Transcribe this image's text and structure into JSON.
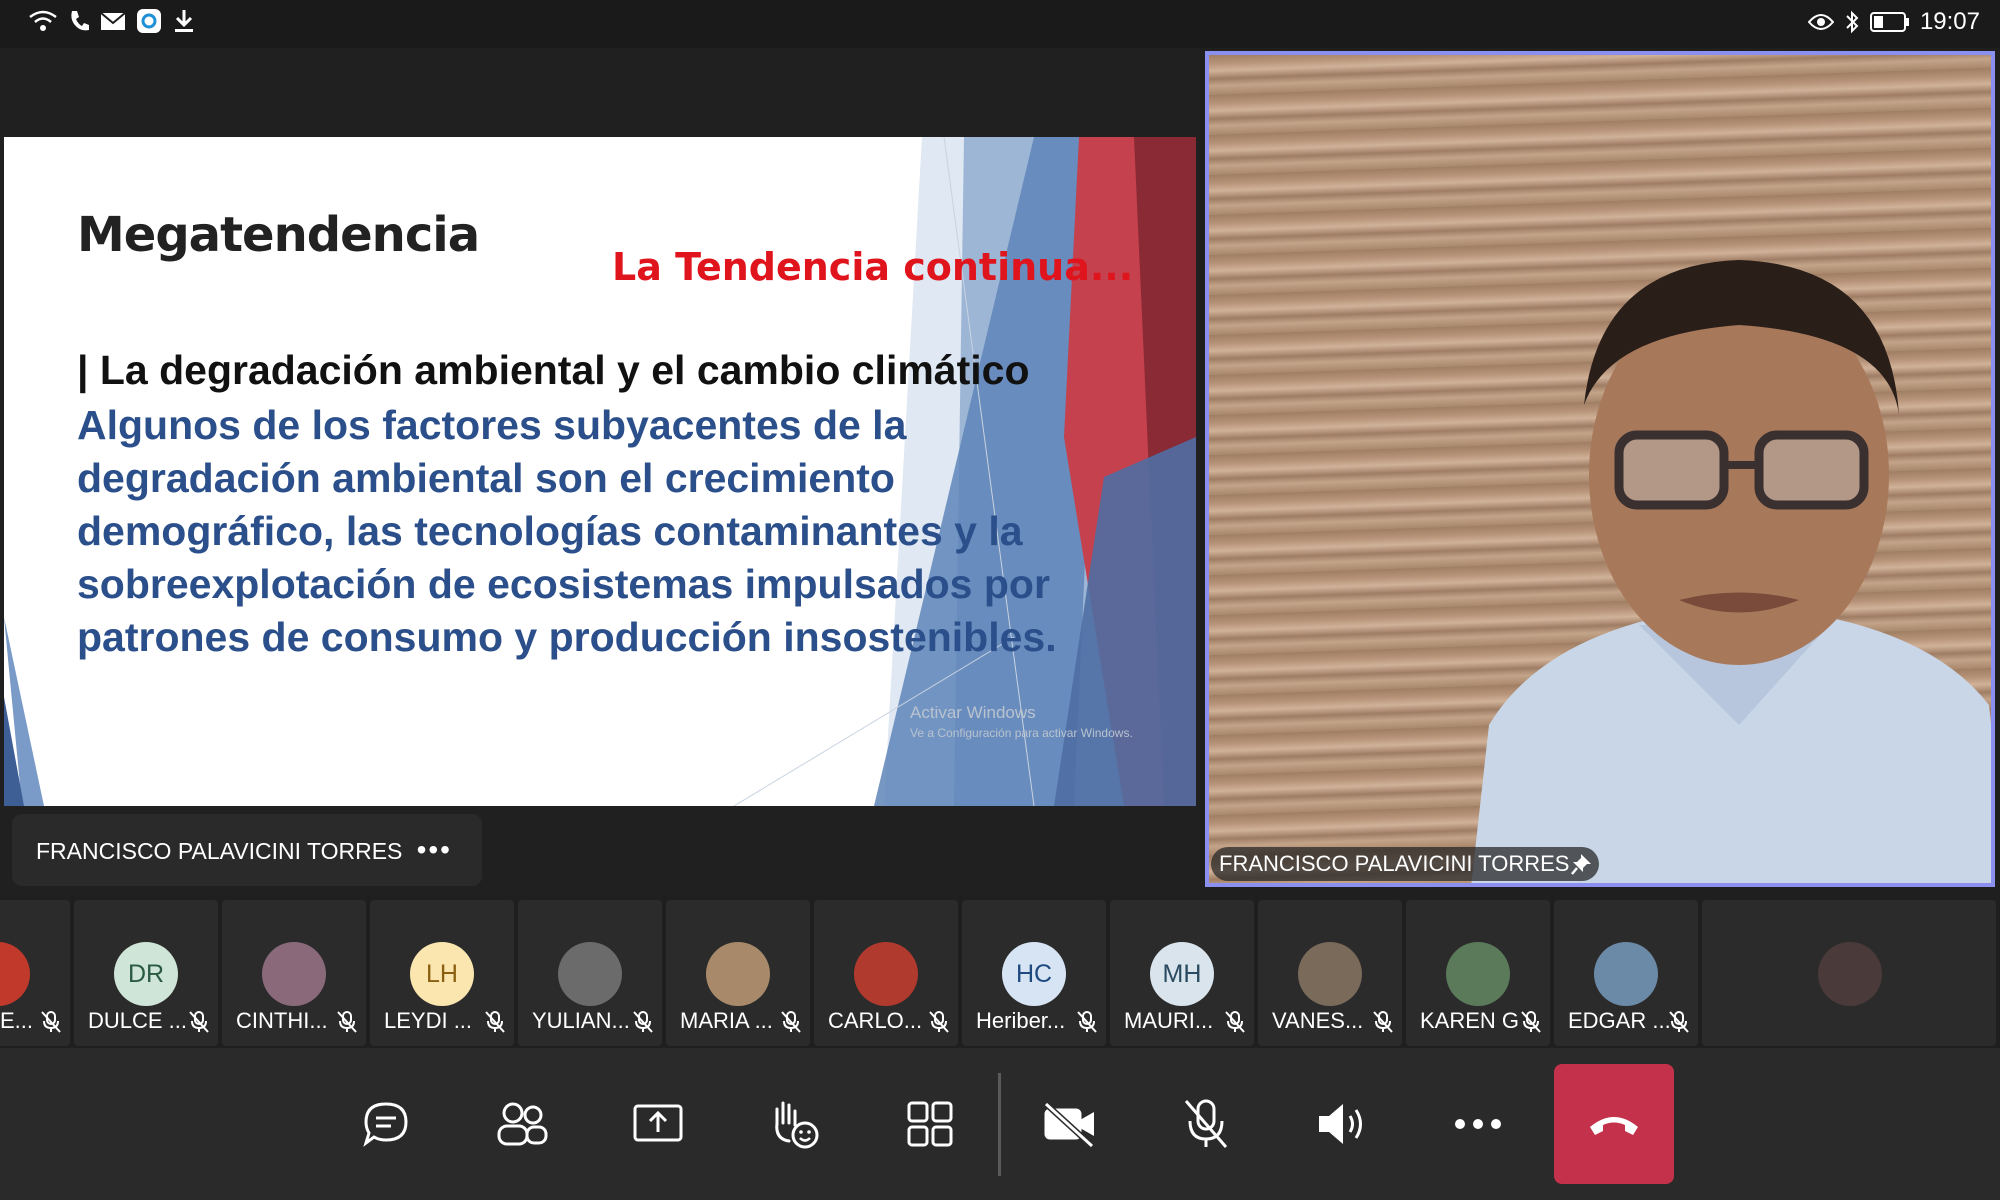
{
  "status_bar": {
    "time": "19:07"
  },
  "slide": {
    "title": "Megatendencia",
    "subtitle": "La Tendencia continua...",
    "heading": "| La degradación ambiental y el cambio climático",
    "body": "Algunos de los factores subyacentes de la degradación ambiental son el crecimiento demográfico, las tecnologías contaminantes y la sobreexplotación de ecosistemas impulsados por patrones de consumo y producción insostenibles.",
    "watermark_title": "Activar Windows",
    "watermark_sub": "Ve a Configuración para activar Windows."
  },
  "presenter": {
    "name": "FRANCISCO PALAVICINI TORRES",
    "more": "•••"
  },
  "video": {
    "name": "FRANCISCO PALAVICINI TORRES"
  },
  "participants": [
    {
      "name": "E...",
      "initials": "",
      "avatar_color": "#c0392b"
    },
    {
      "name": "DULCE ...",
      "initials": "DR",
      "avatar_color": "#cfe5d8"
    },
    {
      "name": "CINTHI...",
      "initials": "",
      "avatar_color": "#8a6a7a"
    },
    {
      "name": "LEYDI ...",
      "initials": "LH",
      "avatar_color": "#fbe6b0"
    },
    {
      "name": "YULIAN...",
      "initials": "",
      "avatar_color": "#6b6b6b"
    },
    {
      "name": "MARIA ...",
      "initials": "",
      "avatar_color": "#a88a6a"
    },
    {
      "name": "CARLO...",
      "initials": "",
      "avatar_color": "#b03a2e"
    },
    {
      "name": "Heriber...",
      "initials": "HC",
      "avatar_color": "#d6e4f4"
    },
    {
      "name": "MAURI...",
      "initials": "MH",
      "avatar_color": "#d9e4ec"
    },
    {
      "name": "VANES...",
      "initials": "",
      "avatar_color": "#7a6a5a"
    },
    {
      "name": "KAREN G",
      "initials": "",
      "avatar_color": "#5a7a5a"
    },
    {
      "name": "EDGAR ...",
      "initials": "",
      "avatar_color": "#6a8aa8"
    },
    {
      "name": "",
      "initials": "",
      "avatar_color": "#4a3a3a"
    }
  ],
  "icons": {
    "chat": "chat-icon",
    "people": "participants-icon",
    "share": "share-screen-icon",
    "reactions": "raise-hand-icon",
    "layout": "grid-layout-icon",
    "camera": "camera-off-icon",
    "mic": "mic-off-icon",
    "speaker": "speaker-icon",
    "more": "more-icon",
    "hangup": "hang-up-icon"
  },
  "colors": {
    "video_border": "#8b8ff0",
    "hangup": "#c4314b",
    "slide_subtitle": "#e0141c",
    "slide_body": "#2b4f8a"
  }
}
